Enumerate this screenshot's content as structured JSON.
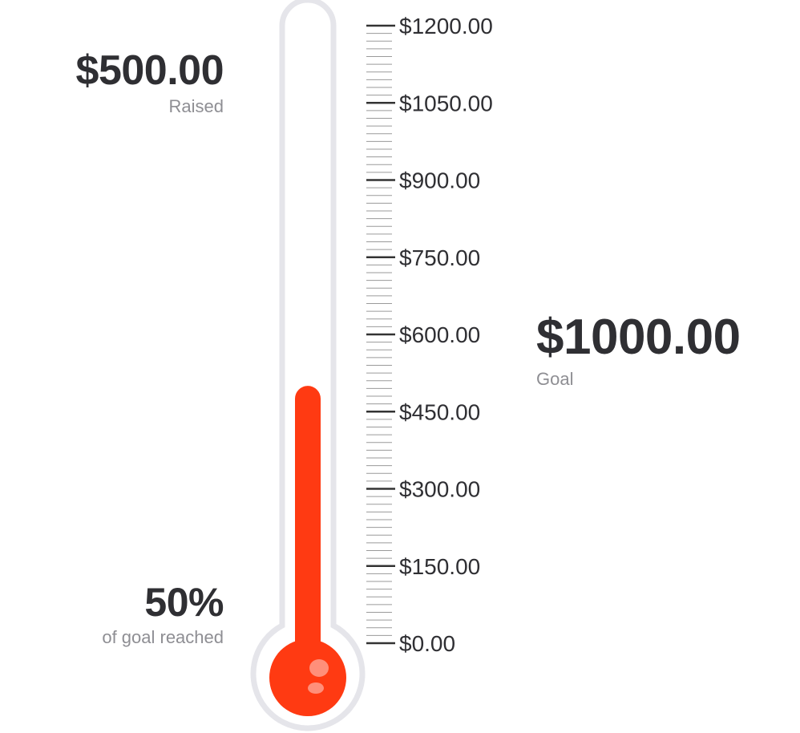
{
  "raised": {
    "amount": "$500.00",
    "label": "Raised"
  },
  "progress": {
    "percent_text": "50%",
    "label": "of goal reached",
    "fraction": 0.5
  },
  "goal": {
    "amount": "$1000.00",
    "label": "Goal"
  },
  "scale": {
    "min": 0,
    "max": 1200,
    "major_step": 150,
    "minor_divisions": 10,
    "tick_labels": [
      "$1200.00",
      "$1050.00",
      "$900.00",
      "$750.00",
      "$600.00",
      "$450.00",
      "$300.00",
      "$150.00",
      "$0.00"
    ]
  },
  "colors": {
    "mercury": "#ff3a12",
    "tube_outline": "#e5e5ea",
    "text_primary": "#2f2f33",
    "text_secondary": "#8e8e93"
  }
}
